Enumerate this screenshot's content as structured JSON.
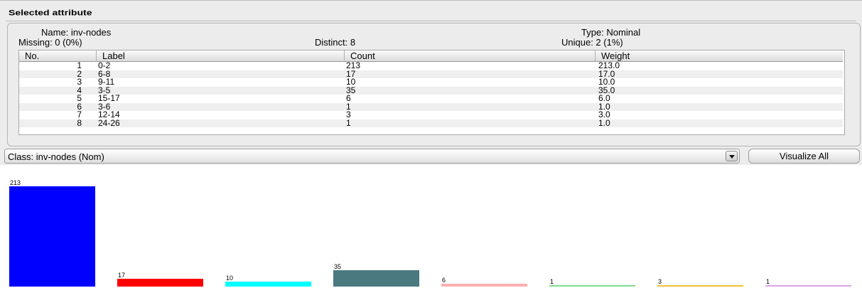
{
  "panel": {
    "title": "Selected attribute",
    "name": "Name:  inv-nodes",
    "missing": "Missing: 0 (0%)",
    "distinct": "Distinct: 8",
    "type": "Type: Nominal",
    "unique": "Unique: 2 (1%)"
  },
  "table": {
    "headers": [
      "No.",
      "Label",
      "Count",
      "Weight"
    ],
    "rows": [
      {
        "no": "1",
        "label": "0-2",
        "count": "213",
        "weight": "213.0"
      },
      {
        "no": "2",
        "label": "6-8",
        "count": "17",
        "weight": "17.0"
      },
      {
        "no": "3",
        "label": "9-11",
        "count": "10",
        "weight": "10.0"
      },
      {
        "no": "4",
        "label": "3-5",
        "count": "35",
        "weight": "35.0"
      },
      {
        "no": "5",
        "label": "15-17",
        "count": "6",
        "weight": "6.0"
      },
      {
        "no": "6",
        "label": "3-6",
        "count": "1",
        "weight": "1.0"
      },
      {
        "no": "7",
        "label": "12-14",
        "count": "3",
        "weight": "3.0"
      },
      {
        "no": "8",
        "label": "24-26",
        "count": "1",
        "weight": "1.0"
      }
    ]
  },
  "class_bar": {
    "selected": "Class:  inv-nodes (Nom)",
    "visualize_label": "Visualize All",
    "dropdown_icon": "chevron-down-icon"
  },
  "chart_data": {
    "type": "bar",
    "categories": [
      "0-2",
      "6-8",
      "9-11",
      "3-5",
      "15-17",
      "3-6",
      "12-14",
      "24-26"
    ],
    "values": [
      213,
      17,
      10,
      35,
      6,
      1,
      3,
      1
    ],
    "colors": [
      "#0000ff",
      "#ff0000",
      "#00ffff",
      "#4a7a80",
      "#ffafaf",
      "#7fdf8f",
      "#f0c030",
      "#dfa0ef"
    ],
    "value_labels": [
      "213",
      "17",
      "10",
      "35",
      "6",
      "1",
      "3",
      "1"
    ],
    "ylim": [
      0,
      213
    ]
  }
}
